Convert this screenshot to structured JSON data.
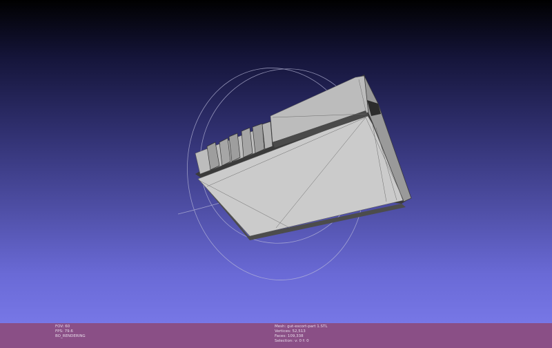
{
  "status_left": {
    "fov": "FOV: 60",
    "fps": "FPS:   79.6",
    "rendering": "BO_RENDERING"
  },
  "status_right": {
    "mesh": "Mesh: gut-escort-part 1.STL",
    "vertices": "Vertices: 52,513",
    "faces": "Faces: 109,338",
    "selection": "Selection: v: 0 f: 0"
  },
  "colors": {
    "status_bar": "#8a4f86",
    "mesh_face": "#c8c8c8",
    "mesh_edge": "#4a4a4a"
  }
}
